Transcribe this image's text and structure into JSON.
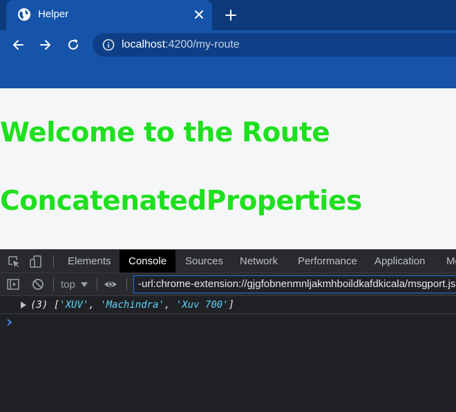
{
  "browser": {
    "tab_title": "Helper",
    "url_host": "localhost",
    "url_rest": ":4200/my-route"
  },
  "page": {
    "heading_1": "Welcome to the Route",
    "heading_2": "ConcatenatedProperties",
    "heading_color": "#1ee01e"
  },
  "devtools": {
    "tabs": [
      "Elements",
      "Console",
      "Sources",
      "Network",
      "Performance",
      "Application",
      "Me"
    ],
    "active_tab": "Console",
    "context": "top",
    "filter_value": "-url:chrome-extension://gjgfobnenmnljakmhboildkafdkicala/msgport.js"
  },
  "console": {
    "count": "(3)",
    "open_bracket": "[",
    "items": [
      "'XUV'",
      "'Machindra'",
      "'Xuv 700'"
    ],
    "separator": ", ",
    "close_bracket": "]"
  },
  "icons": {
    "favicon": "globe-icon",
    "close": "close-icon",
    "new_tab": "plus-icon",
    "back": "back-arrow-icon",
    "forward": "forward-arrow-icon",
    "reload": "reload-icon",
    "site_info": "info-icon",
    "inspect": "inspect-element-icon",
    "device": "device-toolbar-icon",
    "sidebar": "show-sidebar-icon",
    "clear": "clear-console-icon",
    "eye": "live-expression-icon"
  }
}
